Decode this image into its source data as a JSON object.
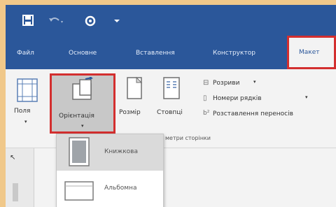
{
  "qat": {
    "icons": [
      "save-icon",
      "undo-icon",
      "touch-mode-icon",
      "customize-icon"
    ]
  },
  "tabs": [
    {
      "label": "Файл"
    },
    {
      "label": "Основне"
    },
    {
      "label": "Вставлення"
    },
    {
      "label": "Конструктор"
    },
    {
      "label": "Макет",
      "active": true
    }
  ],
  "ribbon": {
    "margins_label": "Поля",
    "orientation_label": "Орієнтація",
    "size_label": "Розмір",
    "columns_label": "Стовпці",
    "breaks_label": "Розриви",
    "line_numbers_label": "Номери рядків",
    "hyphenation_label": "Розставлення переносів",
    "group_label": "метри сторінки"
  },
  "orientation_menu": {
    "items": [
      {
        "label": "Книжкова",
        "selected": true
      },
      {
        "label": "Альбомна",
        "selected": false
      }
    ]
  },
  "colors": {
    "brand": "#2b579a",
    "highlight": "#d32f2f",
    "frame": "#f0c88a"
  }
}
